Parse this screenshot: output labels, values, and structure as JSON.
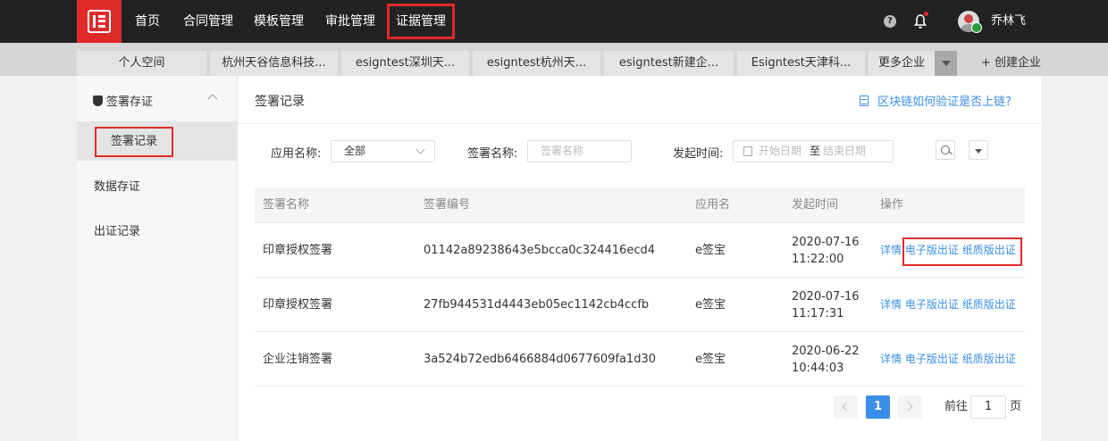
{
  "topnav": {
    "items": [
      "首页",
      "合同管理",
      "模板管理",
      "审批管理",
      "证据管理"
    ],
    "active": "证据管理",
    "help": "?",
    "username": "乔林飞"
  },
  "tabs": {
    "items": [
      "个人空间",
      "杭州天谷信息科技...",
      "esigntest深圳天...",
      "esigntest杭州天...",
      "esigntest新建企...",
      "Esigntest天津科..."
    ],
    "more": "更多企业",
    "create": "+ 创建企业"
  },
  "sidebar": {
    "group": "签署存证",
    "active_item": "签署记录",
    "items": [
      "数据存证",
      "出证记录"
    ]
  },
  "main": {
    "title": "签署记录",
    "chain_link": "区块链如何验证是否上链?"
  },
  "filters": {
    "app_label": "应用名称:",
    "app_value": "全部",
    "sign_label": "签署名称:",
    "sign_placeholder": "签署名称",
    "time_label": "发起时间:",
    "start_placeholder": "开始日期",
    "sep": "至",
    "end_placeholder": "结束日期"
  },
  "table": {
    "headers": [
      "签署名称",
      "签署编号",
      "应用名",
      "发起时间",
      "操作"
    ],
    "rows": [
      {
        "name": "印章授权签署",
        "id": "01142a89238643e5bcca0c324416ecd4",
        "app": "e签宝",
        "date": "2020-07-16",
        "time": "11:22:00"
      },
      {
        "name": "印章授权签署",
        "id": "27fb944531d4443eb05ec1142cb4ccfb",
        "app": "e签宝",
        "date": "2020-07-16",
        "time": "11:17:31"
      },
      {
        "name": "企业注销签署",
        "id": "3a524b72edb6466884d0677609fa1d30",
        "app": "e签宝",
        "date": "2020-06-22",
        "time": "10:44:03"
      }
    ],
    "ops": {
      "detail": "详情",
      "electronic": "电子版出证",
      "paper": "纸质版出证"
    }
  },
  "pagination": {
    "current": "1",
    "goto_prefix": "前往",
    "goto_value": "1",
    "goto_suffix": "页"
  },
  "colors": {
    "accent": "#e02a2a",
    "link": "#3a8ee6",
    "topbar": "#222222"
  }
}
